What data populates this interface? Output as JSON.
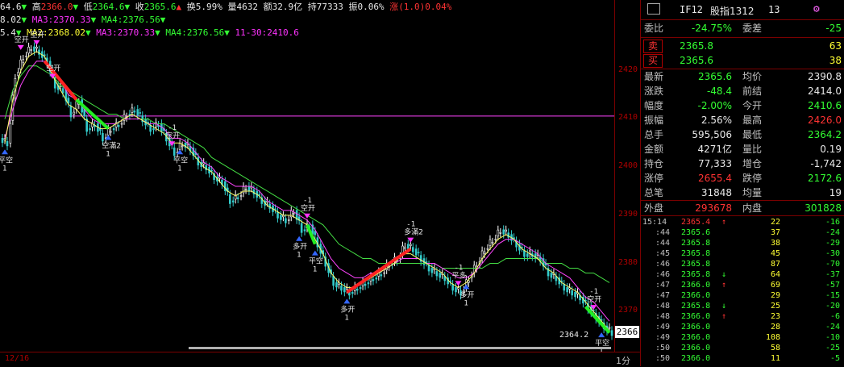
{
  "header": {
    "line1": [
      {
        "t": "64.6",
        "c": "c-white"
      },
      {
        "t": "▼ ",
        "c": "c-green"
      },
      {
        "t": "高",
        "c": "c-white"
      },
      {
        "t": "2366.0",
        "c": "c-red"
      },
      {
        "t": "▼ ",
        "c": "c-green"
      },
      {
        "t": "低",
        "c": "c-white"
      },
      {
        "t": "2364.6",
        "c": "c-green"
      },
      {
        "t": "▼ ",
        "c": "c-green"
      },
      {
        "t": "收",
        "c": "c-white"
      },
      {
        "t": "2365.6",
        "c": "c-green"
      },
      {
        "t": "▲ ",
        "c": "c-red"
      },
      {
        "t": "换5.99% 量4632 额32.9亿 持77333 振0.06% ",
        "c": "c-white"
      },
      {
        "t": "涨",
        "c": "c-red"
      },
      {
        "t": "(1.0)0.04%",
        "c": "c-red"
      }
    ],
    "line2": [
      {
        "t": "8.02",
        "c": "c-white"
      },
      {
        "t": "▼ ",
        "c": "c-green"
      },
      {
        "t": "MA3:2370.33",
        "c": "c-magenta"
      },
      {
        "t": "▼ ",
        "c": "c-green"
      },
      {
        "t": "MA4:2376.56",
        "c": "c-green"
      },
      {
        "t": "▼",
        "c": "c-green"
      }
    ],
    "line3": [
      {
        "t": "5.4",
        "c": "c-white"
      },
      {
        "t": "▼ ",
        "c": "c-green"
      },
      {
        "t": "MA2:2368.02",
        "c": "c-yellow"
      },
      {
        "t": "▼ ",
        "c": "c-green"
      },
      {
        "t": "MA3:2370.33",
        "c": "c-magenta"
      },
      {
        "t": "▼ ",
        "c": "c-green"
      },
      {
        "t": "MA4:2376.56",
        "c": "c-green"
      },
      {
        "t": "▼ ",
        "c": "c-green"
      },
      {
        "t": "11-30:2410.6",
        "c": "c-magenta"
      }
    ]
  },
  "chart_data": {
    "type": "candlestick",
    "y_ticks": [
      2420,
      2410,
      2400,
      2390,
      2380,
      2370
    ],
    "ylim": [
      2363,
      2428
    ],
    "reference_price": 2410.6,
    "last_price_label": "2366",
    "low_label": "2364.2",
    "x_start_label": "12/16",
    "period_label": "1分",
    "close": [
      2405,
      2419,
      2423,
      2425,
      2424,
      2422,
      2417,
      2416,
      2411,
      2414,
      2408,
      2409,
      2406,
      2408,
      2409,
      2411,
      2412,
      2410,
      2408,
      2409,
      2406,
      2403,
      2405,
      2404,
      2401,
      2400,
      2398,
      2397,
      2393,
      2394,
      2396,
      2395,
      2393,
      2392,
      2390,
      2389,
      2391,
      2387,
      2388,
      2384,
      2380,
      2376,
      2375,
      2374,
      2375,
      2376,
      2377,
      2378,
      2380,
      2381,
      2384,
      2383,
      2381,
      2379,
      2378,
      2377,
      2375,
      2374,
      2377,
      2380,
      2383,
      2385,
      2387,
      2386,
      2384,
      2382,
      2382,
      2381,
      2378,
      2377,
      2375,
      2374,
      2373,
      2371,
      2369,
      2367,
      2365.6
    ],
    "ma_short": [
      2405,
      2414,
      2420,
      2423,
      2424,
      2423,
      2419,
      2416,
      2413,
      2412,
      2410,
      2409,
      2408,
      2408,
      2409,
      2410,
      2411,
      2410,
      2409,
      2408,
      2407,
      2405,
      2405,
      2404,
      2402,
      2400,
      2399,
      2397,
      2395,
      2394,
      2395,
      2395,
      2394,
      2392,
      2391,
      2390,
      2390,
      2389,
      2388,
      2385,
      2382,
      2378,
      2376,
      2375,
      2375,
      2376,
      2377,
      2378,
      2379,
      2380,
      2382,
      2382,
      2381,
      2380,
      2379,
      2378,
      2376,
      2375,
      2376,
      2378,
      2381,
      2383,
      2385,
      2386,
      2385,
      2383,
      2382,
      2381,
      2379,
      2378,
      2376,
      2375,
      2374,
      2372,
      2370,
      2368,
      2366
    ],
    "ma_mid": [
      2406,
      2412,
      2417,
      2420,
      2422,
      2422,
      2420,
      2418,
      2415,
      2414,
      2412,
      2410,
      2409,
      2409,
      2409,
      2410,
      2410,
      2410,
      2409,
      2409,
      2408,
      2406,
      2406,
      2405,
      2403,
      2401,
      2400,
      2398,
      2397,
      2396,
      2396,
      2396,
      2395,
      2393,
      2392,
      2391,
      2391,
      2390,
      2389,
      2387,
      2384,
      2381,
      2379,
      2378,
      2377,
      2377,
      2378,
      2378,
      2379,
      2380,
      2381,
      2381,
      2381,
      2380,
      2380,
      2379,
      2378,
      2377,
      2377,
      2378,
      2380,
      2382,
      2384,
      2385,
      2385,
      2384,
      2383,
      2382,
      2380,
      2379,
      2378,
      2377,
      2375,
      2373,
      2372,
      2370,
      2368
    ],
    "ma_long": [
      2410,
      2416,
      2419,
      2421,
      2421,
      2420,
      2419,
      2417,
      2416,
      2415,
      2414,
      2413,
      2412,
      2411,
      2411,
      2410,
      2410,
      2410,
      2410,
      2409,
      2409,
      2408,
      2407,
      2406,
      2405,
      2404,
      2402,
      2401,
      2400,
      2399,
      2398,
      2397,
      2396,
      2395,
      2394,
      2393,
      2392,
      2391,
      2390,
      2389,
      2388,
      2386,
      2384,
      2383,
      2382,
      2381,
      2381,
      2380,
      2380,
      2380,
      2380,
      2380,
      2380,
      2380,
      2380,
      2379,
      2379,
      2379,
      2379,
      2379,
      2379,
      2380,
      2380,
      2381,
      2381,
      2381,
      2381,
      2381,
      2380,
      2380,
      2380,
      2379,
      2379,
      2378,
      2378,
      2377,
      2376
    ],
    "signals": [
      {
        "i": 2,
        "side": "sell",
        "text": "空开",
        "minus": false
      },
      {
        "i": 4,
        "side": "sell",
        "text": "空开",
        "minus": false
      },
      {
        "i": 6,
        "side": "sell",
        "text": "空开",
        "minus": false
      },
      {
        "i": 0,
        "side": "buy",
        "text": "平空",
        "minus": false
      },
      {
        "i": 13,
        "side": "buy",
        "text": "空滿2",
        "minus": false
      },
      {
        "i": 21,
        "side": "sell",
        "text": "空开",
        "minus": true
      },
      {
        "i": 22,
        "side": "buy",
        "text": "平空",
        "minus": false
      },
      {
        "i": 38,
        "side": "sell",
        "text": "空开",
        "minus": true
      },
      {
        "i": 37,
        "side": "buy",
        "text": "多开",
        "minus": false
      },
      {
        "i": 39,
        "side": "buy",
        "text": "平空",
        "minus": false
      },
      {
        "i": 43,
        "side": "buy",
        "text": "多开",
        "minus": false
      },
      {
        "i": 51,
        "side": "sell",
        "text": "多滿2",
        "minus": true
      },
      {
        "i": 57,
        "side": "sell",
        "text": "平多",
        "minus": true
      },
      {
        "i": 58,
        "side": "buy",
        "text": "多开",
        "minus": false
      },
      {
        "i": 74,
        "side": "sell",
        "text": "空开",
        "minus": true
      },
      {
        "i": 75,
        "side": "buy",
        "text": "平空",
        "minus": false
      }
    ],
    "trend_segments": [
      {
        "from": 5,
        "to": 9,
        "color": "#ff2222"
      },
      {
        "from": 9,
        "to": 13,
        "color": "#22ee22"
      },
      {
        "from": 38,
        "to": 39,
        "color": "#22ee22"
      },
      {
        "from": 43,
        "to": 51,
        "color": "#ff2222"
      },
      {
        "from": 73,
        "to": 76,
        "color": "#22ee22"
      }
    ]
  },
  "panel": {
    "title_code": "IF12",
    "title_name": "股指1312",
    "title_num": "13",
    "wei_bi_label": "委比",
    "wei_bi": "-24.75%",
    "wei_cha_label": "委差",
    "wei_cha": "-25",
    "sell_label": "卖",
    "sell_price": "2365.8",
    "sell_vol": "63",
    "buy_label": "买",
    "buy_price": "2365.6",
    "buy_vol": "38",
    "quotes": [
      {
        "l1": "最新",
        "v1": "2365.6",
        "c1": "c-green",
        "l2": "均价",
        "v2": "2390.8",
        "c2": "c-white"
      },
      {
        "l1": "涨跌",
        "v1": "-48.4",
        "c1": "c-green",
        "l2": "前结",
        "v2": "2414.0",
        "c2": "c-white"
      },
      {
        "l1": "幅度",
        "v1": "-2.00%",
        "c1": "c-green",
        "l2": "今开",
        "v2": "2410.6",
        "c2": "c-green"
      },
      {
        "l1": "振幅",
        "v1": "2.56%",
        "c1": "c-white",
        "l2": "最高",
        "v2": "2426.0",
        "c2": "c-red"
      },
      {
        "l1": "总手",
        "v1": "595,506",
        "c1": "c-white",
        "l2": "最低",
        "v2": "2364.2",
        "c2": "c-green"
      },
      {
        "l1": "金额",
        "v1": "4271亿",
        "c1": "c-white",
        "l2": "量比",
        "v2": "0.19",
        "c2": "c-white"
      },
      {
        "l1": "持仓",
        "v1": "77,333",
        "c1": "c-white",
        "l2": "增仓",
        "v2": "-1,742",
        "c2": "c-white"
      },
      {
        "l1": "涨停",
        "v1": "2655.4",
        "c1": "c-red",
        "l2": "跌停",
        "v2": "2172.6",
        "c2": "c-green"
      },
      {
        "l1": "总笔",
        "v1": "31848",
        "c1": "c-white",
        "l2": "均量",
        "v2": "19",
        "c2": "c-white"
      }
    ],
    "outer_label": "外盘",
    "outer_val": "293678",
    "inner_label": "内盘",
    "inner_val": "301828",
    "ticks": [
      {
        "time": "15:14",
        "price": "2365.4",
        "pc": "c-red",
        "arrow": "↑",
        "ac": "c-red",
        "vol": "22",
        "oi": "-16"
      },
      {
        "time": ":44",
        "price": "2365.6",
        "pc": "c-green",
        "arrow": "",
        "ac": "",
        "vol": "37",
        "oi": "-24"
      },
      {
        "time": ":44",
        "price": "2365.8",
        "pc": "c-green",
        "arrow": "",
        "ac": "",
        "vol": "38",
        "oi": "-29"
      },
      {
        "time": ":45",
        "price": "2365.8",
        "pc": "c-green",
        "arrow": "",
        "ac": "",
        "vol": "45",
        "oi": "-30"
      },
      {
        "time": ":46",
        "price": "2365.8",
        "pc": "c-green",
        "arrow": "",
        "ac": "",
        "vol": "87",
        "oi": "-70"
      },
      {
        "time": ":46",
        "price": "2365.8",
        "pc": "c-green",
        "arrow": "↓",
        "ac": "c-green",
        "vol": "64",
        "oi": "-37"
      },
      {
        "time": ":47",
        "price": "2366.0",
        "pc": "c-green",
        "arrow": "↑",
        "ac": "c-red",
        "vol": "69",
        "oi": "-57"
      },
      {
        "time": ":47",
        "price": "2366.0",
        "pc": "c-green",
        "arrow": "",
        "ac": "",
        "vol": "29",
        "oi": "-15"
      },
      {
        "time": ":48",
        "price": "2365.8",
        "pc": "c-green",
        "arrow": "↓",
        "ac": "c-green",
        "vol": "25",
        "oi": "-20"
      },
      {
        "time": ":48",
        "price": "2366.0",
        "pc": "c-green",
        "arrow": "↑",
        "ac": "c-red",
        "vol": "23",
        "oi": "-6"
      },
      {
        "time": ":49",
        "price": "2366.0",
        "pc": "c-green",
        "arrow": "",
        "ac": "",
        "vol": "28",
        "oi": "-24"
      },
      {
        "time": ":49",
        "price": "2366.0",
        "pc": "c-green",
        "arrow": "",
        "ac": "",
        "vol": "108",
        "oi": "-10"
      },
      {
        "time": ":50",
        "price": "2366.0",
        "pc": "c-green",
        "arrow": "",
        "ac": "",
        "vol": "58",
        "oi": "-25"
      },
      {
        "time": ":50",
        "price": "2366.0",
        "pc": "c-green",
        "arrow": "",
        "ac": "",
        "vol": "11",
        "oi": "-5"
      }
    ]
  },
  "colors": {
    "up": "#ff3333",
    "down": "#33ff33",
    "frame": "#7a0000",
    "ma_short": "#ffff66",
    "ma_mid": "#ff44ff",
    "ma_long": "#44dd44",
    "ref": "#ff44ff"
  }
}
